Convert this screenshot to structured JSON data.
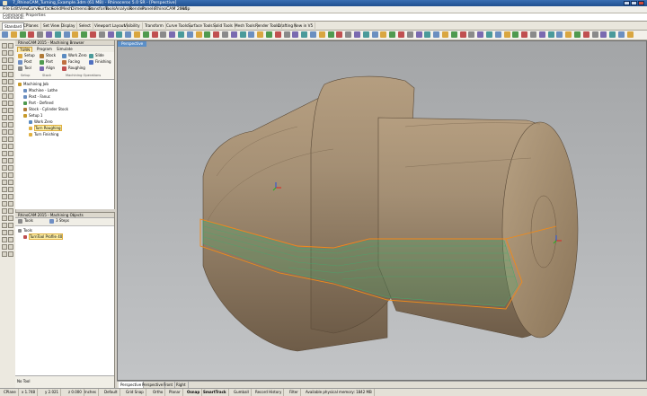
{
  "window": {
    "title": "7_RhinoCAM_Turning_Example.3dm (61 MB) - Rhinoceros 5.0 SR - [Perspective]"
  },
  "menubar": [
    "File",
    "Edit",
    "View",
    "Curve",
    "Surface",
    "Solid",
    "Mesh",
    "Dimension",
    "Transform",
    "Tools",
    "Analysis",
    "Render",
    "Panels",
    "RhinoCAM 2015",
    "Help"
  ],
  "command": {
    "line1": "Command: Properties",
    "line2": "Command:"
  },
  "toolbar_tabs": [
    "Standard",
    "CPlanes",
    "Set View",
    "Display",
    "Select",
    "Viewport Layout",
    "Visibility",
    "Transform",
    "Curve Tools",
    "Surface Tools",
    "Solid Tools",
    "Mesh Tools",
    "Render Tools",
    "Drafting",
    "New in V5"
  ],
  "browser": {
    "title": "RhinoCAM 2015 - Machining Browser",
    "tabs": [
      "TURN",
      "Program",
      "Simulate"
    ],
    "ribbon": {
      "items": [
        "Setup",
        "Post",
        "Tool",
        "Stock",
        "Part",
        "Align",
        "Work Zero",
        "Facing",
        "Roughing",
        "Slide",
        "Finishing",
        "Groove",
        "Threading",
        "Parting",
        "Holes"
      ],
      "groups": [
        "Setup",
        "Stock",
        "Machining Operations"
      ]
    },
    "tree": [
      {
        "label": "Machining Job",
        "level": 0,
        "color": "#c89a2a"
      },
      {
        "label": "Machine - Lathe",
        "level": 1,
        "color": "#6b8fc0"
      },
      {
        "label": "Post - Fanuc",
        "level": 1,
        "color": "#6b8fc0"
      },
      {
        "label": "Part - Defined",
        "level": 1,
        "color": "#4f9a4f"
      },
      {
        "label": "Stock - Cylinder Stock",
        "level": 1,
        "color": "#b07a38"
      },
      {
        "label": "Setup 1",
        "level": 1,
        "color": "#c89a2a"
      },
      {
        "label": "Work Zero",
        "level": 2,
        "color": "#5a8ac0"
      },
      {
        "label": "Turn Roughing",
        "level": 2,
        "color": "#e0b040",
        "selected": true
      },
      {
        "label": "Turn Finishing",
        "level": 2,
        "color": "#e0b040"
      }
    ]
  },
  "objects": {
    "title": "RhinoCAM 2015 - Machining Objects",
    "toolbar": [
      "Tools",
      "3 Steps"
    ],
    "tree": [
      {
        "label": "Tools",
        "level": 0
      },
      {
        "label": "TurnTool Profile 40",
        "level": 1,
        "selected": true
      }
    ],
    "bottom": "No Tool"
  },
  "viewport": {
    "title": "Perspective",
    "tabs": [
      "Perspective",
      "Perspective",
      "Front",
      "Right"
    ]
  },
  "status": {
    "items": [
      "CPlane",
      "x 1.748",
      "y 2.021",
      "z 0.000",
      "Inches",
      "Default",
      "Grid Snap",
      "Ortho",
      "Planar",
      "Osnap",
      "SmartTrack",
      "Gumball",
      "Record History",
      "Filter",
      "Available physical memory: 1842 MB"
    ],
    "on": [
      "Osnap",
      "SmartTrack"
    ]
  },
  "colors": {
    "part_body": "#a48f74",
    "part_shadow": "#6e5c48",
    "part_light": "#c2ab8c",
    "stock_outline": "#f08a1a",
    "toolpath": "#3fae6e",
    "axis_x": "#e02020",
    "axis_y": "#20b020",
    "axis_z": "#2050e0"
  }
}
